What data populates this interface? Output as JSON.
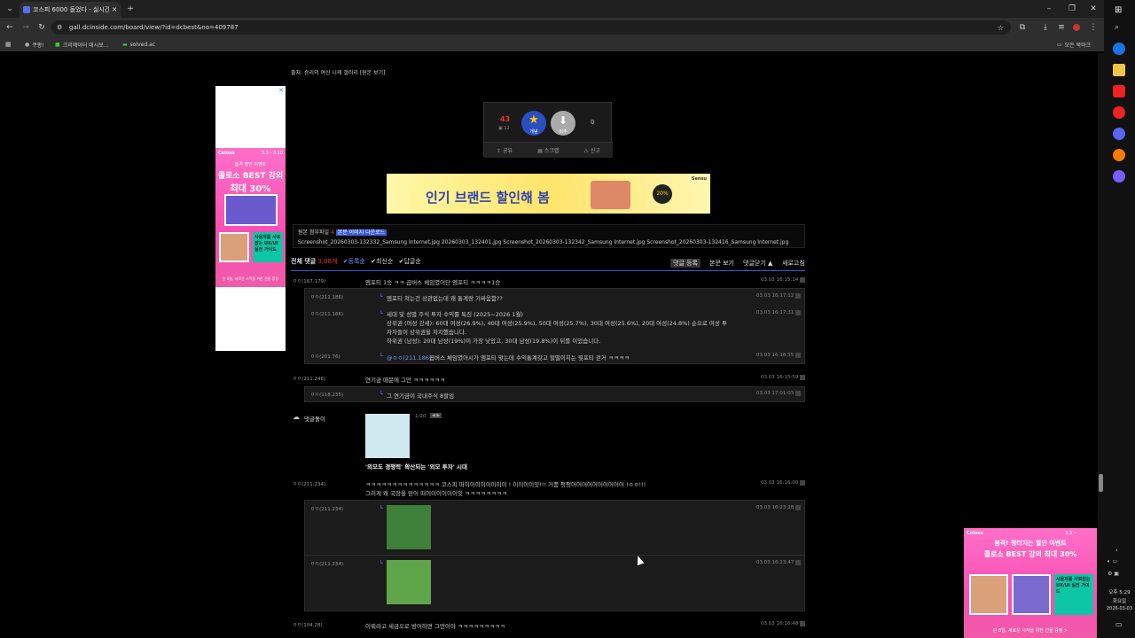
{
  "browser": {
    "tab_title": "코스피 6000 돌었다 - 실시간 ...",
    "new_tab": "+",
    "url": "gall.dcinside.com/board/view/?id=dcbest&no=409787",
    "bookmarks": [
      "쿠팡!",
      "크리에이터 대시보...",
      "solved.ac"
    ],
    "all_bookmarks": "모든 북마크"
  },
  "article": {
    "source_prefix": "출처:",
    "source": "승리의 여신 니케 갤러리 [원본 보기]",
    "vote": {
      "up_count": "43",
      "fixed_count": "12",
      "up_label": "개념",
      "down_label": "비추",
      "down_count": "0",
      "share": "공유",
      "scrap": "스크랩",
      "report": "신고"
    },
    "ad_banner_text": "인기 브랜드 할인해 봄",
    "ad_banner_badge": "20%",
    "ad_banner_brand": "Sensu",
    "files_label": "원본 첨부파일",
    "files_count": "4",
    "files_btn": "본문 이미지 다운로드",
    "files": "Screenshot_20260303-132332_Samsung Internet.jpg   20260303_132401.jpg   Screenshot_20260303-132342_Samsung Internet.jpg   Screenshot_20260303-132416_Samsung Internet.jpg"
  },
  "ads": {
    "brand": "Coloso",
    "date": "3.3 - 3.10",
    "headline": "봄격 할인 이벤트",
    "title": "콜로소 BEST 강의",
    "discount": "최대 30%",
    "footer": "단 8일, 새로운 시작을 위한 선물 증정",
    "right_date": "3.3 ~",
    "right_headline": "봄격! 펑터지는 할인 이벤트",
    "right_title": "콜로소 BEST 강의 최대 30%",
    "right_footer": "단 8일, 새로운 시작을 위한 선물 증정 >",
    "card_text": "사용자를 사로잡는 UX/UI 실전 가이드"
  },
  "comments_header": {
    "label": "전체 댓글",
    "count": "3,08개",
    "sort": [
      "등록순",
      "최신순",
      "답글순"
    ],
    "write": "댓글 등록",
    "view_body": "본문 보기",
    "fold": "댓글닫기 ▲",
    "refresh": "새로고침"
  },
  "comments": [
    {
      "nick": "ㅇㅇ(167.179)",
      "text": "엠포티 1승 ㅋㅋ 곱버스 체임였어단 엠포티 ㅋㅋㅋㅋ1승",
      "date": "03.03 16:15:14"
    },
    {
      "nick": "ㅇㅇ(211.186)",
      "text": "엠포티 쳐는건 상관없는데 왜 통계랑 기싸움함??",
      "date": "03.03 16:17:12",
      "reply": true
    },
    {
      "nick": "ㅇㅇ(211.186)",
      "text": "세대 및 성별 주식 투자 수익률 특징 (2025~2026 1월)",
      "text2": "상위권 (여성 강세): 60대 여성(26.9%), 40대 여성(25.9%), 50대 여성(25.7%), 30대 여성(25.6%), 20대 여성(24.8%) 순으로 여성 투",
      "text3": "자자들이 상위권을 차지했습니다.",
      "text4": "하위권 (남성): 20대 남성(19%)이 가장 낮았고, 30대 남성(19.8%)이 뒤를 이었습니다.",
      "date": "03.03 16:17:31",
      "reply": true
    },
    {
      "nick": "ㅇㅇ(201.76)",
      "mention": "@ㅇㅇ(211.186)",
      "text": "곱버스 체임였어시가 엠포티 맞는데 수익통계갖고 헐떨이치는 뭣포티 걷거 ㅋㅋㅋㅋ",
      "date": "03.03 16:18:55",
      "reply": true
    },
    {
      "nick": "ㅇㅇ(211.246)",
      "text": "연기금 때문에 그만 ㅋㅋㅋㅋㅋㅋ",
      "date": "03.03 16:15:59"
    },
    {
      "nick": "ㅇㅇ(118.235)",
      "text": "그 연기금이 국내주식 8할임",
      "date": "03.03 17:01:03",
      "reply": true
    },
    {
      "nick": "댓글돌이",
      "caption": "'외모도 경쟁력' 확산되는 '외모 투자' 시대",
      "pager": "1/20"
    },
    {
      "nick": "ㅇㅇ(211.234)",
      "text": "ㅋㅋㅋㅋㅋㅋㅋㅋㅋㅋㅋㅋㅋㅋ 코스피 떠이이이이이이이이 ! 이이이이잇!!! 거품 펑펑어어어어어어어어어어 !ㅇㅇ!!!",
      "text2": "그러게 왜 국장을 믿어 떠이이이이이이잇 ㅋㅋㅋㅋㅋㅋㅋㅋ",
      "date": "03.03 16:16:00"
    },
    {
      "nick": "ㅇㅇ(211.234)",
      "date": "03.03 16:23:28",
      "reply": true
    },
    {
      "nick": "ㅇㅇ(211.234)",
      "date": "03.03 16:23:47",
      "reply": true
    },
    {
      "nick": "ㅇㅇ(104.28)",
      "text": "이뤄라고 세금으로 방어하면 그만이야 ㅋㅋㅋㅋㅋㅋㅋㅋㅋ",
      "date": "03.03 16:16:48"
    }
  ],
  "taskbar": {
    "time": "오후 5:29",
    "day": "화요일",
    "date": "2026-03-03"
  }
}
